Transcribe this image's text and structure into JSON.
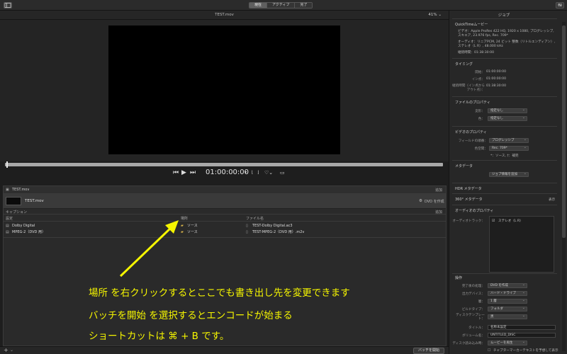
{
  "toolbar": {
    "tabs": [
      {
        "label": "現在",
        "active": true
      },
      {
        "label": "アクティブ",
        "active": false
      },
      {
        "label": "完了",
        "active": false
      }
    ],
    "left_icon": "sidebar-icon",
    "right_icon": "inspector-icon"
  },
  "viewer": {
    "title": "TEST.mov",
    "zoom": "41%",
    "timecode": "01:00:00:00"
  },
  "batch": {
    "header_title": "TEST.mov",
    "header_right": "追加",
    "job_name": "TEST.mov",
    "job_action": "DVD を作成",
    "caption_label": "キャプション",
    "caption_add": "追加",
    "columns": {
      "setting": "設定",
      "location": "場所",
      "filename": "ファイル名"
    },
    "outputs": [
      {
        "setting": "Dolby Digital",
        "location": "ソース",
        "filename": "TEST-Dolby Digital.ac3"
      },
      {
        "setting": "MPEG-2（DVD 用）",
        "location": "ソース",
        "filename": "TEST-MPEG-2（DVD 用）.m2v"
      }
    ],
    "start_button": "バッチを開始"
  },
  "annotation": {
    "line1": "場所 を右クリックするとここでも書き出し先を変更できます",
    "line2": "バッチを開始 を選択するとエンコードが始まる",
    "line3": "ショートカットは ⌘ + B です。",
    "color": "#f5f500"
  },
  "inspector": {
    "title": "ジョブ",
    "file_type": "QuickTimeムービー",
    "video_info": "ビデオ：Apple ProRes 422 HQ, 1920 x 1080, プログレッシブ, スキエア, 23.976 fps, Rec. 709*",
    "audio_info": "オーディオ：リニアPCM, 24 ビット 整数（リトルエンディアン）, ステレオ（L R）, 48.000 kHz",
    "duration_label": "継続時間：01:38:30:00",
    "timing": {
      "title": "タイミング",
      "start_label": "開始：",
      "start": "01:00:00:00",
      "in_label": "イン点：",
      "in": "01:00:00:00",
      "dur_label": "継続時間（イン点からアウト点）：",
      "dur": "01:38:30:00"
    },
    "file_props": {
      "title": "ファイルのプロパティ",
      "row1_label": "変形：",
      "row1": "指定なし",
      "row2_label": "色：",
      "row2": "指定なし"
    },
    "video_props": {
      "title": "ビデオのプロパティ",
      "field_label": "フィールドの順番：",
      "field": "プログレッシブ",
      "color_label": "色空間：",
      "color": "Rec. 709*",
      "note": "*：ソース, †：補完"
    },
    "metadata": {
      "title": "メタデータ",
      "button": "ジョブ情報を追加"
    },
    "hdr": "HDR メタデータ",
    "vr": "360° メタデータ",
    "vr_right": "表示",
    "audio_props": {
      "title": "オーディオのプロパティ",
      "track_label": "オーディオトラック：",
      "track": "ステレオ（L R）"
    },
    "action": {
      "title": "操作",
      "when_done_label": "完了後の処理：",
      "when_done": "DVD を作成",
      "output_label": "出力デバイス：",
      "output": "ハード・ドライブ",
      "layers_label": "層：",
      "layers": "1 層",
      "build_label": "ビルドタイプ：",
      "build": "フォルダ",
      "template_label": "ディスクテンプレート：",
      "template": "黒",
      "title_label": "タイトル：",
      "title_val": "名称未設定",
      "volume_label": "ボリューム名：",
      "volume": "UNTITLED_DISC",
      "loop_label": "ディスク読み込み時：",
      "loop": "ムービーを再生",
      "check_label": "チャプターマーカーテキストを予想して表示"
    }
  }
}
